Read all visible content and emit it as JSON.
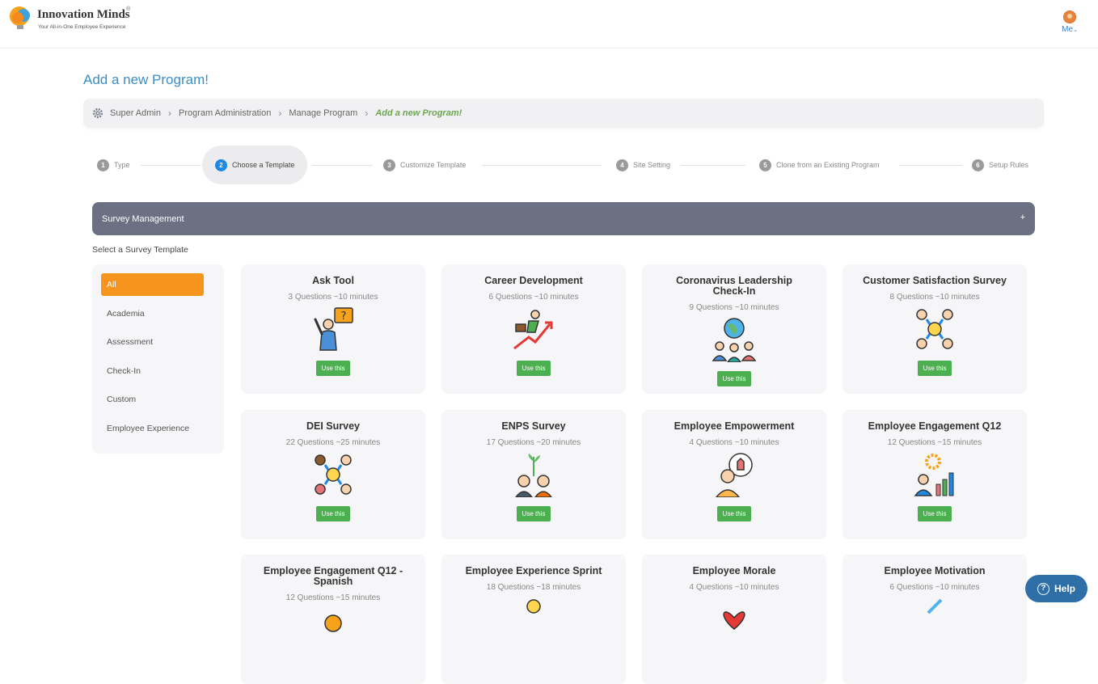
{
  "app": {
    "brand_name": "Innovation Minds",
    "brand_registered": "®",
    "tagline": "Your All-in-One Employee Experience",
    "user_label": "Me"
  },
  "page": {
    "title": "Add a new Program!"
  },
  "breadcrumb": {
    "items": [
      "Super Admin",
      "Program Administration",
      "Manage Program"
    ],
    "current": "Add a new Program!",
    "separator": "›"
  },
  "stepper": {
    "active_index": 1,
    "steps": [
      {
        "num": "1",
        "label": "Type"
      },
      {
        "num": "2",
        "label": "Choose a Template"
      },
      {
        "num": "3",
        "label": "Customize Template"
      },
      {
        "num": "4",
        "label": "Site Setting"
      },
      {
        "num": "5",
        "label": "Clone from an Existing Program"
      },
      {
        "num": "6",
        "label": "Setup Rules"
      }
    ]
  },
  "section": {
    "title": "Survey Management",
    "toggle": "+"
  },
  "templates": {
    "select_label": "Select a Survey Template",
    "categories": [
      "All",
      "Academia",
      "Assessment",
      "Check-In",
      "Custom",
      "Employee Experience"
    ],
    "active_category": "All",
    "use_label": "Use this",
    "cards": [
      {
        "title": "Ask Tool",
        "meta": "3 Questions ~10 minutes",
        "icon": "question-person-icon"
      },
      {
        "title": "Career Development",
        "meta": "6 Questions ~10 minutes",
        "icon": "career-growth-icon"
      },
      {
        "title": "Coronavirus Leadership Check-In",
        "meta": "9 Questions ~10 minutes",
        "icon": "globe-team-icon"
      },
      {
        "title": "Customer Satisfaction Survey",
        "meta": "8 Questions ~10 minutes",
        "icon": "customer-circle-icon"
      },
      {
        "title": "DEI Survey",
        "meta": "22 Questions ~25 minutes",
        "icon": "diversity-circle-icon"
      },
      {
        "title": "ENPS Survey",
        "meta": "17 Questions ~20 minutes",
        "icon": "growing-team-icon"
      },
      {
        "title": "Employee Empowerment",
        "meta": "4 Questions ~10 minutes",
        "icon": "empowerment-icon"
      },
      {
        "title": "Employee Engagement Q12",
        "meta": "12 Questions ~15 minutes",
        "icon": "engagement-chart-icon"
      },
      {
        "title": "Employee Engagement Q12 - Spanish",
        "meta": "12 Questions ~15 minutes",
        "icon": "engagement-spanish-icon"
      },
      {
        "title": "Employee Experience Sprint",
        "meta": "18 Questions ~18 minutes",
        "icon": "experience-sprint-icon"
      },
      {
        "title": "Employee Morale",
        "meta": "4 Questions ~10 minutes",
        "icon": "morale-heart-icon"
      },
      {
        "title": "Employee Motivation",
        "meta": "6 Questions ~10 minutes",
        "icon": "motivation-icon"
      }
    ]
  },
  "help": {
    "label": "Help",
    "icon_glyph": "?"
  },
  "colors": {
    "accent_blue": "#3b8ec4",
    "active_orange": "#f7941d",
    "use_green": "#4caf50",
    "section_gray": "#6b7183",
    "help_blue": "#2f6fa8"
  }
}
